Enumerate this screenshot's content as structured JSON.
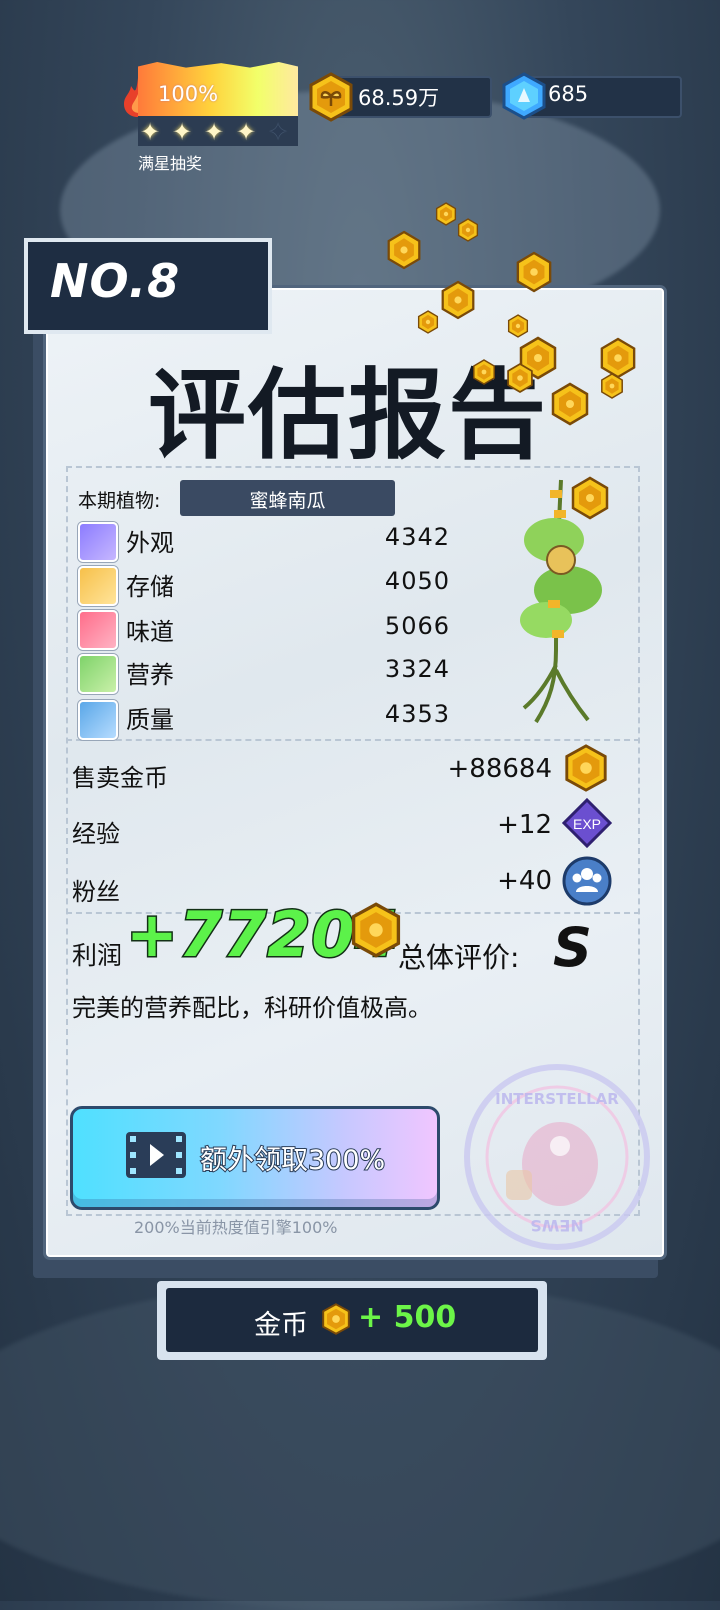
{
  "hud": {
    "heat_percent": "100%",
    "stars_filled": 4,
    "stars_total": 5,
    "stars_label": "满星抽奖",
    "coins": "68.59万",
    "gems": "685"
  },
  "report": {
    "number": "NO.8",
    "title": "评估报告",
    "plant_label": "本期植物:",
    "plant_name": "蜜蜂南瓜",
    "attributes": [
      {
        "name": "外观",
        "value": "4342",
        "icon": "sparkle-icon"
      },
      {
        "name": "存储",
        "value": "4050",
        "icon": "box-icon"
      },
      {
        "name": "味道",
        "value": "5066",
        "icon": "fork-knife-icon"
      },
      {
        "name": "营养",
        "value": "3324",
        "icon": "frog-bowl-icon"
      },
      {
        "name": "质量",
        "value": "4353",
        "icon": "muscle-arm-icon"
      }
    ],
    "rewards": {
      "gold_label": "售卖金币",
      "gold_value": "+88684",
      "exp_label": "经验",
      "exp_value": "+12",
      "exp_badge": "EXP",
      "fans_label": "粉丝",
      "fans_value": "+40"
    },
    "profit_label": "利润",
    "profit_value": "+77204",
    "rating_label": "总体评价:",
    "rating_value": "S",
    "comment": "完美的营养配比，科研价值极高。",
    "bonus_button": "额外领取300%",
    "bonus_sub": "200%当前热度值引擎100%",
    "stamp_text_top": "INTERSTELLAR",
    "stamp_text_bottom": "NEWS"
  },
  "claim_button": {
    "label": "金币",
    "value": "+ 500"
  },
  "colors": {
    "profit_green": "#5cf24a",
    "gold": "#f5b800",
    "panel_dark": "#1c2a3e"
  }
}
